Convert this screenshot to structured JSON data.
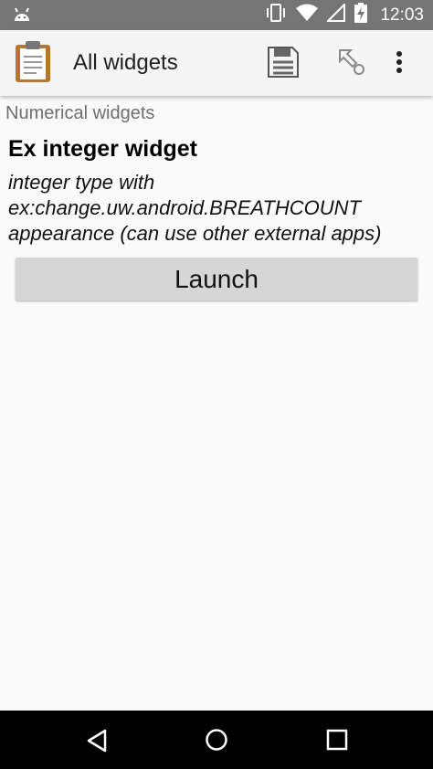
{
  "status_bar": {
    "time": "12:03",
    "icons": [
      "android-icon",
      "vibrate-icon",
      "wifi-icon",
      "signal-icon",
      "battery-charging-icon"
    ]
  },
  "app_bar": {
    "title": "All widgets",
    "icons": [
      "clipboard-icon",
      "save-icon",
      "go-to-icon",
      "overflow-menu-icon"
    ]
  },
  "content": {
    "group_label": "Numerical widgets",
    "question_label": "Ex integer widget",
    "hint_lines": [
      "integer type with",
      "ex:change.uw.android.BREATHCOUNT",
      "appearance (can use other external apps)"
    ],
    "launch_label": "Launch"
  },
  "nav_bar": {
    "icons": [
      "back-icon",
      "home-icon",
      "recents-icon"
    ]
  },
  "colors": {
    "status_bar": "#757575",
    "app_bar": "#f5f5f5",
    "background": "#fafafa",
    "button": "#d6d6d6",
    "nav_bar": "#000000"
  }
}
